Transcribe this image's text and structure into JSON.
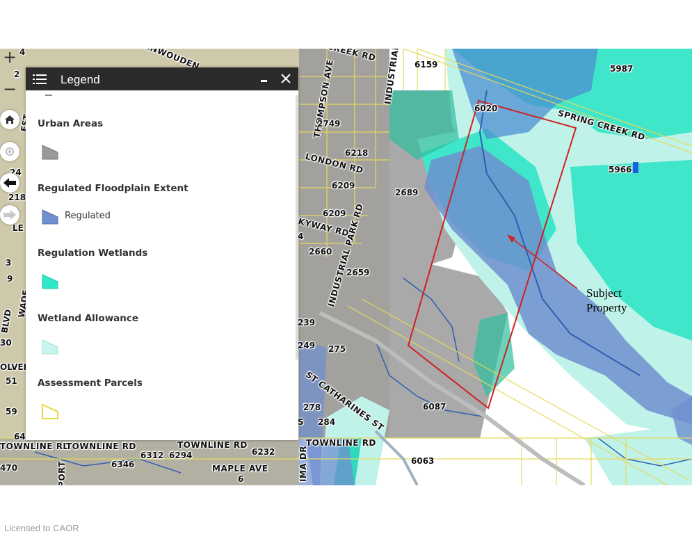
{
  "legend": {
    "title": "Legend",
    "minimize_icon": "minimize-icon",
    "close_icon": "close-icon",
    "sections": [
      {
        "name": "Urban Areas",
        "color": "#9a9a9a"
      },
      {
        "name": "Regulated Floodplain Extent",
        "item": "Regulated",
        "color": "#6f8fcf"
      },
      {
        "name": "Regulation Wetlands",
        "color": "#2ee8c8"
      },
      {
        "name": "Wetland Allowance",
        "color": "#c9f5ee"
      },
      {
        "name": "Assessment Parcels",
        "color": "#f0e040"
      }
    ]
  },
  "map_controls": {
    "zoom_in": "+",
    "zoom_out": "−",
    "home_icon": "home-icon",
    "locate_icon": "locate-icon",
    "back_icon": "back-arrow-icon",
    "forward_icon": "forward-arrow-icon"
  },
  "map": {
    "annotation": [
      "Subject",
      "Property"
    ],
    "roads": {
      "vanwoudenberg": "VANWOUDEN",
      "creek": "CREEK RD",
      "industrial": "INDUSTRIAL",
      "thompson": "THOMPSON AVE",
      "london": "LONDON RD",
      "kyway": "KYWAY RD",
      "industrial_park": "INDUSTRIAL PARK RD",
      "spring_creek": "SPRING CREEK RD",
      "st_catharines": "ST CATHARINES ST",
      "townline_1": "TOWNLINE RD",
      "townline_2": "TOWNLINE RD",
      "townline_3": "TOWNLINE RD",
      "townline_4": "TOWNLINE RD",
      "maple": "MAPLE AVE",
      "port": "PORT",
      "ima": "IMA DR"
    },
    "numbers": {
      "n6159": "6159",
      "n5987": "5987",
      "n6020": "6020",
      "n2749": "2749",
      "n6218": "6218",
      "n5966": "5966",
      "n6209a": "6209",
      "n2689": "2689",
      "n6209b": "6209",
      "n2660": "2660",
      "n2659": "2659",
      "n239": "239",
      "n249": "249",
      "n275": "275",
      "n278": "278",
      "n284": "284",
      "n6087": "6087",
      "n6232": "6232",
      "n6312": "6312",
      "n6294": "6294",
      "n6346": "6346",
      "n6063": "6063",
      "n470": "470",
      "n6": "6",
      "e4": "4",
      "e2": "2",
      "e218": "218",
      "e24": "24",
      "e3": "3",
      "e9": "9",
      "e30": "30",
      "e51": "51",
      "e59": "59",
      "e64": "64",
      "e4b": "4",
      "wade": "WADE",
      "blvd": "BLVD",
      "olver": "OLVER",
      "est": "EST",
      "le": "LE",
      "s": "S"
    }
  },
  "footer": {
    "license": "Licensed to CAOR"
  }
}
